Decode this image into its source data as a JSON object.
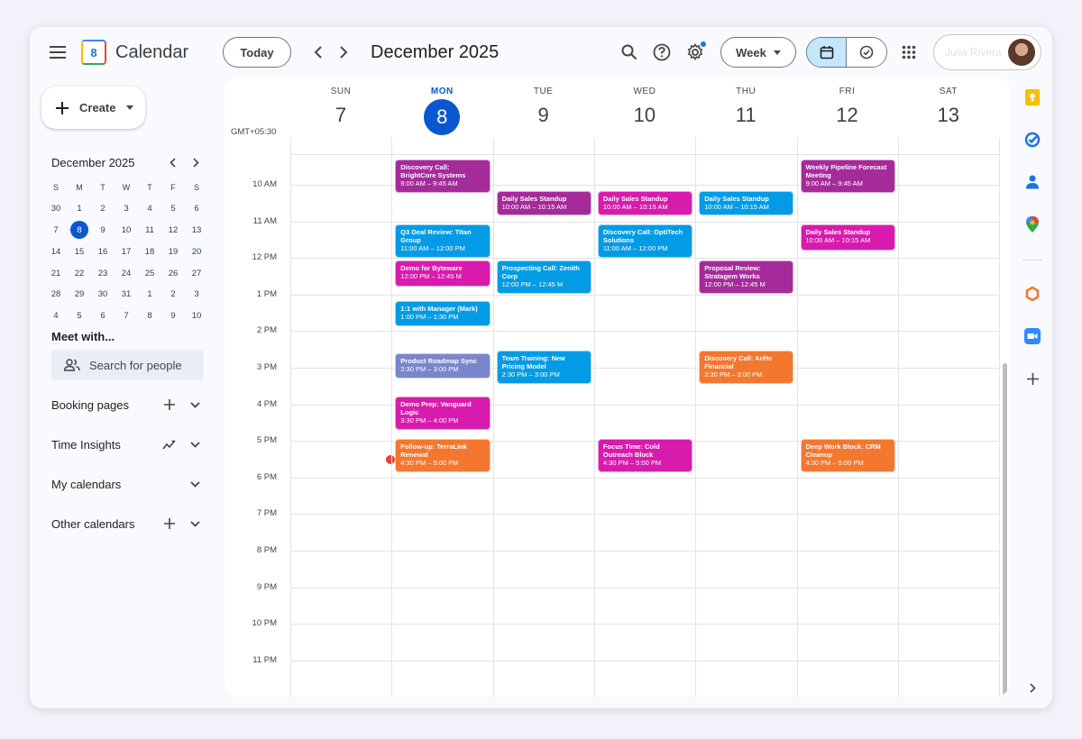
{
  "header": {
    "app_title": "Calendar",
    "logo_day": "8",
    "today_label": "Today",
    "month_title": "December 2025",
    "view_label": "Week",
    "account_name": "Julia Rivera"
  },
  "sidebar": {
    "create_label": "Create",
    "mini_calendar": {
      "title": "December 2025",
      "weekdays": [
        "S",
        "M",
        "T",
        "W",
        "T",
        "F",
        "S"
      ],
      "weeks": [
        [
          "30",
          "1",
          "2",
          "3",
          "4",
          "5",
          "6"
        ],
        [
          "7",
          "8",
          "9",
          "10",
          "11",
          "12",
          "13"
        ],
        [
          "14",
          "15",
          "16",
          "17",
          "18",
          "19",
          "20"
        ],
        [
          "21",
          "22",
          "23",
          "24",
          "25",
          "26",
          "27"
        ],
        [
          "28",
          "29",
          "30",
          "31",
          "1",
          "2",
          "3"
        ],
        [
          "4",
          "5",
          "6",
          "7",
          "8",
          "9",
          "10"
        ]
      ],
      "selected": "8"
    },
    "meet_title": "Meet with...",
    "search_people_placeholder": "Search for people",
    "sections": {
      "booking": "Booking pages",
      "insights": "Time Insights",
      "my_calendars": "My calendars",
      "other_calendars": "Other calendars"
    }
  },
  "week": {
    "timezone": "GMT+05:30",
    "days": [
      {
        "dow": "SUN",
        "num": "7"
      },
      {
        "dow": "MON",
        "num": "8"
      },
      {
        "dow": "TUE",
        "num": "9"
      },
      {
        "dow": "WED",
        "num": "10"
      },
      {
        "dow": "THU",
        "num": "11"
      },
      {
        "dow": "FRI",
        "num": "12"
      },
      {
        "dow": "SAT",
        "num": "13"
      }
    ],
    "hours": [
      "10 AM",
      "11 AM",
      "12 PM",
      "1 PM",
      "2 PM",
      "3 PM",
      "4 PM",
      "5 PM",
      "6 PM",
      "7 PM",
      "8 PM",
      "9 PM",
      "10 PM",
      "11 PM"
    ]
  },
  "colors": {
    "purple": "#a52b9a",
    "blue": "#039be5",
    "magenta": "#d81bac",
    "lavender": "#7986cb",
    "orange": "#f4772f",
    "accent": "#0b57d0"
  },
  "events": [
    {
      "title": "Discovery Call: BrightCore Systems",
      "time": "9:00 AM – 9:45 AM",
      "color": "#a52b9a"
    },
    {
      "title": "Q3 Deal Review: Titan Group",
      "time": "11:00 AM – 12:00 PM",
      "color": "#039be5"
    },
    {
      "title": "Demo for Byteware",
      "time": "12:00 PM – 12:45 M",
      "color": "#d81bac"
    },
    {
      "title": "1:1 with Manager (Mark)",
      "time": "1:00 PM – 1:30 PM",
      "color": "#039be5"
    },
    {
      "title": "Product Roadmap Sync",
      "time": "2:30 PM – 3:00 PM",
      "color": "#7986cb"
    },
    {
      "title": "Demo Prep: Vanguard Logic",
      "time": "3:30 PM – 4:00 PM",
      "color": "#d81bac"
    },
    {
      "title": "Follow-up: TerraLink Renewal",
      "time": "4:30 PM – 5:00 PM",
      "color": "#f4772f"
    },
    {
      "title": "Daily Sales Standup",
      "time": "10:00 AM – 10:15 AM",
      "color": "#a52b9a"
    },
    {
      "title": "Prospecting Call: Zenith Corp",
      "time": "12:00 PM – 12:45 M",
      "color": "#039be5"
    },
    {
      "title": "Team Training: New Pricing Model",
      "time": "2:30 PM – 3:00 PM",
      "color": "#039be5"
    },
    {
      "title": "Daily Sales Standup",
      "time": "10:00 AM – 10:15 AM",
      "color": "#d81bac"
    },
    {
      "title": "Discovery Call: OptiTech Solutions",
      "time": "11:00 AM – 12:00 PM",
      "color": "#039be5"
    },
    {
      "title": "Focus Time: Cold Outreach Block",
      "time": "4:30 PM – 5:00 PM",
      "color": "#d81bac"
    },
    {
      "title": "Daily Sales Standup",
      "time": "10:00 AM – 10:15 AM",
      "color": "#039be5"
    },
    {
      "title": "Proposal Review: Stratagem Works",
      "time": "12:00 PM – 12:45 M",
      "color": "#a52b9a"
    },
    {
      "title": "Discovery Call: Arête Financial",
      "time": "2:30 PM – 3:00 PM",
      "color": "#f4772f"
    },
    {
      "title": "Weekly Pipeline Forecast Meeting",
      "time": "9:00 AM – 9:45 AM",
      "color": "#a52b9a"
    },
    {
      "title": "Daily Sales Standup",
      "time": "10:00 AM – 10:15 AM",
      "color": "#d81bac"
    },
    {
      "title": "Deep Work Block: CRM Cleanup",
      "time": "4:30 PM – 5:00 PM",
      "color": "#f4772f"
    }
  ]
}
